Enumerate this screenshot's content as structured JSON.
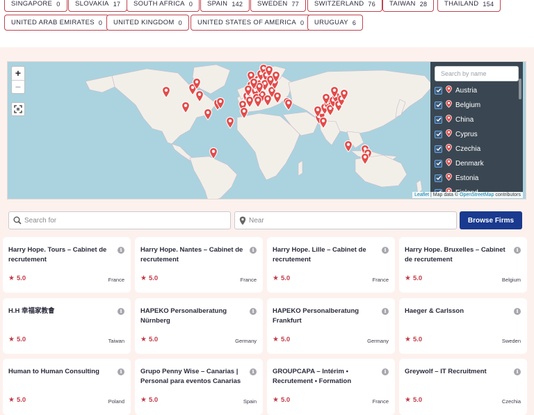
{
  "chips_row1": [
    {
      "name": "SINGAPORE",
      "count": "0"
    },
    {
      "name": "SLOVAKIA",
      "count": "17"
    },
    {
      "name": "SOUTH AFRICA",
      "count": "0"
    },
    {
      "name": "SPAIN",
      "count": "142"
    },
    {
      "name": "SWEDEN",
      "count": "77"
    },
    {
      "name": "SWITZERLAND",
      "count": "76"
    },
    {
      "name": "TAIWAN",
      "count": "28"
    },
    {
      "name": "THAILAND",
      "count": "154"
    }
  ],
  "chips_row2": [
    {
      "name": "UNITED ARAB EMIRATES",
      "count": "0"
    },
    {
      "name": "UNITED KINGDOM",
      "count": "0"
    },
    {
      "name": "UNITED STATES OF AMERICA",
      "count": "0"
    },
    {
      "name": "URUGUAY",
      "count": "6"
    }
  ],
  "map": {
    "zoom_in": "+",
    "zoom_out": "−",
    "search_placeholder": "Search by name",
    "countries": [
      "Austria",
      "Belgium",
      "China",
      "Cyprus",
      "Czechia",
      "Denmark",
      "Estonia",
      "Finland"
    ],
    "attribution_leaflet": "Leaflet",
    "attribution_sep": " | Map data © ",
    "attribution_osm": "OpenStreetMap",
    "attribution_end": " contributors",
    "marker_color": "#e24c4b"
  },
  "search": {
    "search_placeholder": "Search for",
    "near_placeholder": "Near",
    "browse_label": "Browse Firms"
  },
  "firms": [
    {
      "name": "Harry Hope. Tours – Cabinet de recrutement",
      "rating": "5.0",
      "country": "France"
    },
    {
      "name": "Harry Hope. Nantes – Cabinet de recrutement",
      "rating": "5.0",
      "country": "France"
    },
    {
      "name": "Harry Hope. Lille – Cabinet de recrutement",
      "rating": "5.0",
      "country": "France"
    },
    {
      "name": "Harry Hope. Bruxelles – Cabinet de recrutement",
      "rating": "5.0",
      "country": "Belgium"
    },
    {
      "name": "H.H 幸福家教會",
      "rating": "5.0",
      "country": "Taiwan"
    },
    {
      "name": "HAPEKO Personalberatung Nürnberg",
      "rating": "5.0",
      "country": "Germany"
    },
    {
      "name": "HAPEKO Personalberatung Frankfurt",
      "rating": "5.0",
      "country": "Germany"
    },
    {
      "name": "Haeger & Carlsson",
      "rating": "5.0",
      "country": "Sweden"
    },
    {
      "name": "Human to Human Consulting",
      "rating": "5.0",
      "country": "Poland"
    },
    {
      "name": "Grupo Penny Wise – Canarias | Personal para eventos Canarias",
      "rating": "5.0",
      "country": "Spain"
    },
    {
      "name": "GROUPCAPA – Intérim • Recrutement • Formation",
      "rating": "5.0",
      "country": "France"
    },
    {
      "name": "Greywolf – IT Recruitment",
      "rating": "5.0",
      "country": "Czechia"
    }
  ],
  "colors": {
    "accent": "#c0424d",
    "button": "#1a3a8f",
    "section_bg": "#fdf1ee"
  }
}
